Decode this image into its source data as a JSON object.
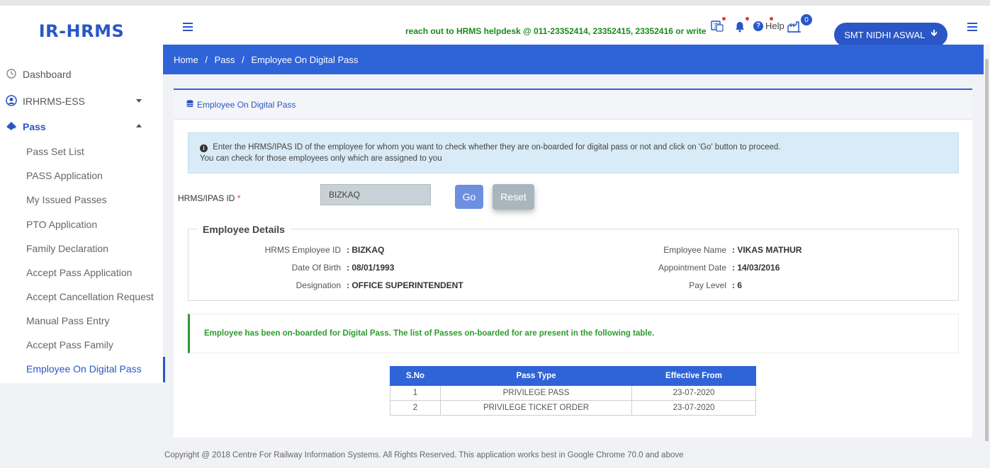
{
  "header": {
    "brand": "IR-HRMS",
    "helpdesk_text": "reach out to HRMS helpdesk @ 011-23352414, 23352415, 23352416 or write",
    "help_label": "Help",
    "help_glyph": "?",
    "notification_count": "0",
    "user_name": "SMT NIDHI ASWAL",
    "user_arrow": "🡻"
  },
  "sidebar": {
    "dashboard": "Dashboard",
    "ess": "IRHRMS-ESS",
    "pass": "Pass",
    "items": [
      "Pass Set List",
      "PASS Application",
      "My Issued Passes",
      "PTO Application",
      "Family Declaration",
      "Accept Pass Application",
      "Accept Cancellation Request",
      "Manual Pass Entry",
      "Accept Pass Family",
      "Employee On Digital Pass"
    ],
    "active_item": "Employee On Digital Pass"
  },
  "breadcrumb": {
    "home": "Home",
    "pass": "Pass",
    "current": "Employee On Digital Pass",
    "separator": "/"
  },
  "card": {
    "title": "Employee On Digital Pass",
    "info_line1": "Enter the HRMS/IPAS ID of the employee for whom you want to check whether they are on-boarded for digital pass or not and click on 'Go' button to proceed.",
    "info_line2": "You can check for those employees only which are assigned to you"
  },
  "form": {
    "id_label": "HRMS/IPAS ID",
    "required_mark": "*",
    "id_value": "BIZKAQ",
    "go_label": "Go",
    "reset_label": "Reset"
  },
  "employee": {
    "legend": "Employee Details",
    "hrms_id_label": "HRMS Employee ID",
    "hrms_id_value": ": BIZKAQ",
    "dob_label": "Date Of Birth",
    "dob_value": ": 08/01/1993",
    "designation_label": "Designation",
    "designation_value": ": OFFICE SUPERINTENDENT",
    "name_label": "Employee Name",
    "name_value": ": VIKAS MATHUR",
    "appointment_label": "Appointment Date",
    "appointment_value": ": 14/03/2016",
    "pay_level_label": "Pay Level",
    "pay_level_value": ": 6"
  },
  "success_message": "Employee has been on-boarded for Digital Pass. The list of Passes on-boarded for are present in the following table.",
  "table": {
    "headers": [
      "S.No",
      "Pass Type",
      "Effective From"
    ],
    "rows": [
      [
        "1",
        "PRIVILEGE PASS",
        "23-07-2020"
      ],
      [
        "2",
        "PRIVILEGE TICKET ORDER",
        "23-07-2020"
      ]
    ]
  },
  "footer": "Copyright @ 2018 Centre For Railway Information Systems. All Rights Reserved. This application works best in Google Chrome 70.0 and above",
  "colors": {
    "accent": "#2f63d8",
    "success": "#2e9a2e",
    "info_bg": "#d8ebf6"
  },
  "icons": {
    "menu": "hamburger-icon",
    "translate": "translate-icon",
    "bell": "bell-icon",
    "help": "help-circle-icon",
    "factory": "factory-icon",
    "dashboard": "clock-icon",
    "user": "user-circle-icon",
    "pass": "ticket-icon",
    "database": "database-icon",
    "info": "info-circle-icon"
  }
}
